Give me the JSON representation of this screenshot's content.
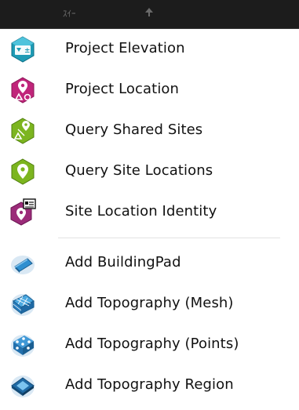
{
  "header": {
    "title": "ｽｲｰ"
  },
  "group1": [
    {
      "label": "Project Elevation",
      "icon": "project-elevation-icon"
    },
    {
      "label": "Project Location",
      "icon": "project-location-icon"
    },
    {
      "label": "Query Shared Sites",
      "icon": "query-shared-sites-icon"
    },
    {
      "label": "Query Site Locations",
      "icon": "query-site-locations-icon"
    },
    {
      "label": "Site Location Identity",
      "icon": "site-location-identity-icon"
    }
  ],
  "group2": [
    {
      "label": "Add BuildingPad",
      "icon": "building-pad-icon"
    },
    {
      "label": "Add Topography (Mesh)",
      "icon": "topography-mesh-icon"
    },
    {
      "label": "Add Topography (Points)",
      "icon": "topography-points-icon"
    },
    {
      "label": "Add Topography Region",
      "icon": "topography-region-icon"
    }
  ],
  "colors": {
    "teal": "#1e9bb5",
    "magenta": "#c0257a",
    "green": "#7cb51f",
    "purple": "#9b2b79",
    "blueLight": "#7bbbe3"
  }
}
